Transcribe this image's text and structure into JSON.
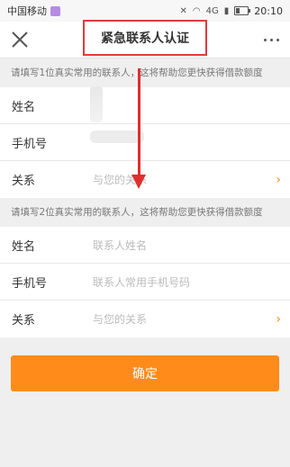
{
  "status_bar": {
    "carrier": "中国移动",
    "network": "4G",
    "time": "20:10"
  },
  "header": {
    "title": "紧急联系人认证"
  },
  "section1": {
    "hint": "请填写1位真实常用的联系人，这将帮助您更快获得借款额度",
    "rows": [
      {
        "label": "姓名",
        "value": ""
      },
      {
        "label": "手机号",
        "value": ""
      },
      {
        "label": "关系",
        "value": "与您的关系"
      }
    ]
  },
  "section2": {
    "hint": "请填写2位真实常用的联系人，这将帮助您更快获得借款额度",
    "rows": [
      {
        "label": "姓名",
        "value": "联系人姓名"
      },
      {
        "label": "手机号",
        "value": "联系人常用手机号码"
      },
      {
        "label": "关系",
        "value": "与您的关系"
      }
    ]
  },
  "confirm_label": "确定",
  "colors": {
    "accent": "#ff8c1a",
    "highlight": "#e33a3a"
  }
}
